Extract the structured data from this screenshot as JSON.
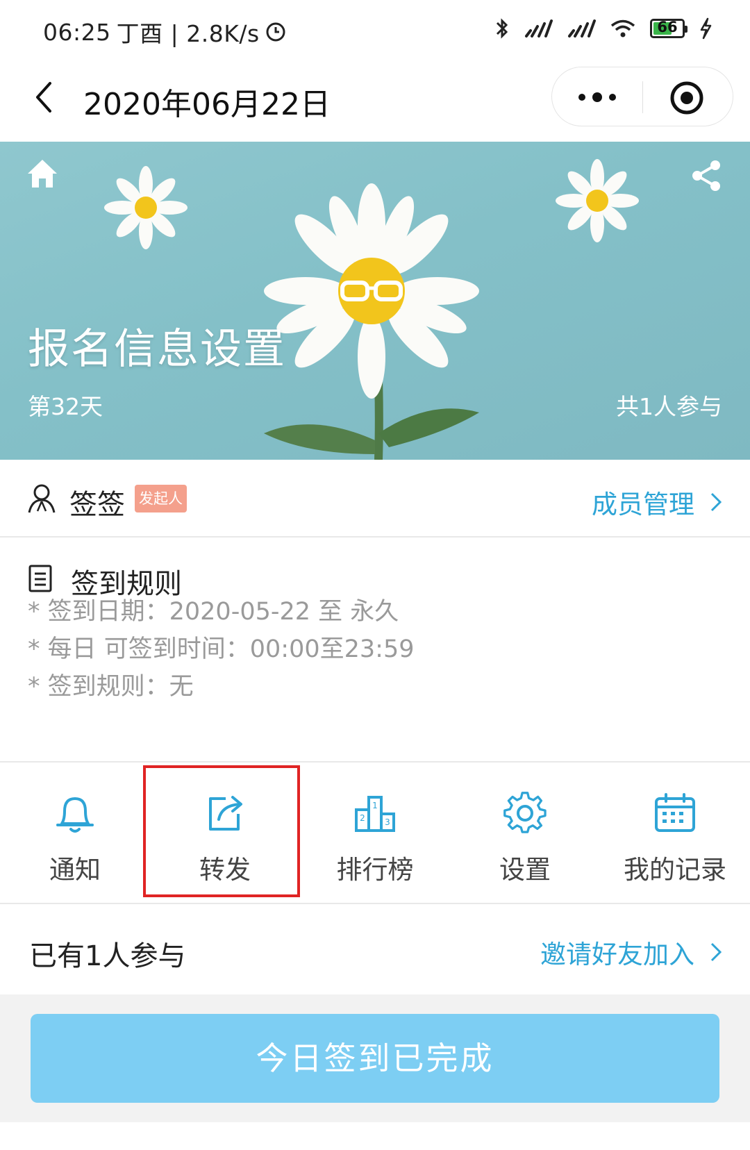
{
  "status_bar": {
    "time": "06:25",
    "extra": "丁酉 | 2.8K/s",
    "battery_level": "66"
  },
  "nav": {
    "title": "2020年06月22日"
  },
  "banner": {
    "title": "报名信息设置",
    "day_label": "第32天",
    "participant_label": "共1人参与"
  },
  "creator": {
    "name": "签签",
    "badge": "发起人",
    "members_link": "成员管理"
  },
  "rules": {
    "title": "签到规则",
    "lines": [
      "* 签到日期：2020-05-22 至 永久",
      "* 每日 可签到时间：00:00至23:59",
      "* 签到规则：无"
    ]
  },
  "toolbar": {
    "items": [
      {
        "label": "通知",
        "icon": "bell-icon"
      },
      {
        "label": "转发",
        "icon": "share-arrow-icon"
      },
      {
        "label": "排行榜",
        "icon": "podium-icon"
      },
      {
        "label": "设置",
        "icon": "gear-icon"
      },
      {
        "label": "我的记录",
        "icon": "calendar-icon"
      }
    ]
  },
  "participants": {
    "summary": "已有1人参与",
    "invite_link": "邀请好友加入"
  },
  "checkin": {
    "button_label": "今日签到已完成"
  },
  "colors": {
    "accent_blue": "#2ea4d6",
    "checkin_button": "#7dcef3",
    "badge": "#f4a08c",
    "highlight_red": "#e02424"
  }
}
